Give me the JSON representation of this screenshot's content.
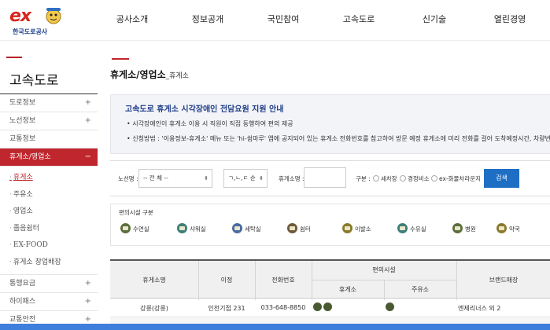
{
  "header": {
    "logo_mark": "ex",
    "logo_text": "한국도로공사",
    "nav": [
      "공사소개",
      "정보공개",
      "국민참여",
      "고속도로",
      "신기술",
      "열린경영"
    ]
  },
  "sidebar": {
    "title": "고속도로",
    "items_top": [
      {
        "label": "도로정보",
        "plus": "+"
      },
      {
        "label": "노선정보",
        "plus": "+"
      },
      {
        "label": "교통정보",
        "plus": ""
      }
    ],
    "active": {
      "label": "휴게소/영업소",
      "toggle": "−"
    },
    "sub_items": [
      "휴게소",
      "주유소",
      "영업소",
      "졸음쉼터",
      "EX-FOOD",
      "휴게소 창업배장"
    ],
    "items_bottom": [
      {
        "label": "통행요금",
        "plus": "+"
      },
      {
        "label": "하이패스",
        "plus": "+"
      },
      {
        "label": "교통안전",
        "plus": "+"
      }
    ]
  },
  "main": {
    "title": "휴게소/영업소",
    "title_sub": "_휴게소",
    "notice": {
      "title": "고속도로 휴게소 시각장애인 전담요원 지원 안내",
      "lines": [
        "• 시각장애인이 휴게소 이용 시 직원이 직접 동행하여 편의 제공",
        "• 신청방법 : '이용정보-휴게소' 메뉴 또는 'hi-쉼마루' 앱에 공지되어 있는 휴게소 전화번호를 참고하여 방문 예정 휴게소에 미리 전화를 걸어 도착예정시간, 차량번호, 필요"
      ]
    },
    "search": {
      "route_label": "노선명 :",
      "route_value": "-- 전 체 --",
      "order_value": "ㄱ,ㄴ,ㄷ 순",
      "name_label": "휴게소명 :",
      "name_value": "",
      "type_label": "구분 :",
      "radios": [
        "세차장",
        "경정비소",
        "ex-화물차라운지"
      ],
      "button": "검색"
    },
    "facility": {
      "title": "편의시설 구분",
      "items": [
        {
          "label": "수면실",
          "icon": "bed-icon"
        },
        {
          "label": "샤워실",
          "icon": "shower-icon"
        },
        {
          "label": "세탁실",
          "icon": "laundry-icon"
        },
        {
          "label": "쉼터",
          "icon": "rest-icon"
        },
        {
          "label": "이발소",
          "icon": "barber-icon"
        },
        {
          "label": "수유실",
          "icon": "nursing-icon"
        },
        {
          "label": "병원",
          "icon": "hospital-icon"
        },
        {
          "label": "약국",
          "icon": "pharmacy-icon"
        }
      ]
    },
    "table": {
      "headers": {
        "name": "휴게소명",
        "distance": "이정",
        "phone": "전화번호",
        "facilities": "편의시설",
        "rest": "휴게소",
        "gas": "주유소",
        "brand": "브랜드매장"
      },
      "rows": [
        {
          "name": "강릉(강릉)",
          "distance": "인천기점 231",
          "phone": "033-648-8850",
          "brand": "엔제리너스 외 2"
        }
      ]
    }
  },
  "colors": {
    "accent": "#c0262d",
    "button": "#1e6fc4",
    "notice_title": "#1f3c88",
    "outer_bg": "#3e7fdc"
  }
}
